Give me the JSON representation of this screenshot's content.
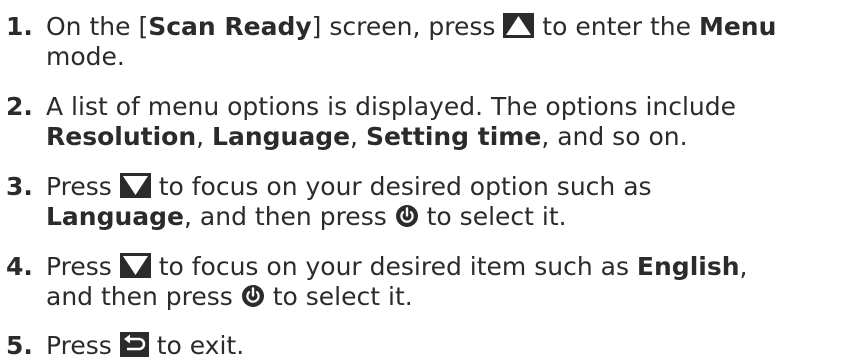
{
  "steps": [
    {
      "number": "1.",
      "t1": "On the [",
      "b1": "Scan Ready",
      "t2": "] screen, press ",
      "icon1": "up-button-icon",
      "t3": " to enter the ",
      "b2": "Menu",
      "t4": "mode."
    },
    {
      "number": "2.",
      "t1": "A list of menu options is displayed. The options include",
      "b1": "Resolution",
      "t2": ", ",
      "b2": "Language",
      "t3": ", ",
      "b3": "Setting time",
      "t4": ", and so on."
    },
    {
      "number": "3.",
      "t1": "Press ",
      "icon1": "down-button-icon",
      "t2": " to focus on your desired option such as",
      "b1": "Language",
      "t3": ", and then press ",
      "icon2": "power-button-icon",
      "t4": " to select it."
    },
    {
      "number": "4.",
      "t1": "Press ",
      "icon1": "down-button-icon",
      "t2": " to focus on your desired item such as ",
      "b1": "English",
      "t3": ",",
      "t4": "and then press ",
      "icon2": "power-button-icon",
      "t5": " to select it."
    },
    {
      "number": "5.",
      "t1": "Press ",
      "icon1": "return-button-icon",
      "t2": " to exit."
    }
  ]
}
